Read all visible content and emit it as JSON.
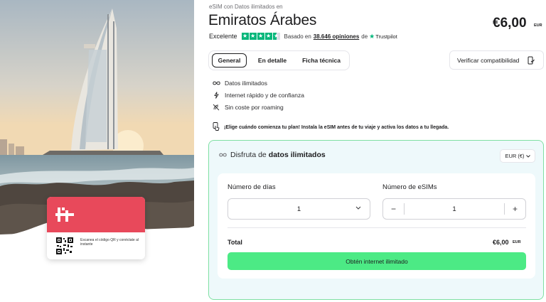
{
  "product": {
    "supertitle": "eSIM con Datos ilimitados en",
    "title": "Emiratos Árabes",
    "price": "€6,00",
    "price_currency": "EUR"
  },
  "rating": {
    "label": "Excelente",
    "stars": 4.5,
    "based_on": "Basado en",
    "count": "38.646 opiniones",
    "of": "de",
    "provider": "Trustpilot"
  },
  "tabs": [
    {
      "label": "General",
      "active": true
    },
    {
      "label": "En detalle",
      "active": false
    },
    {
      "label": "Ficha técnica",
      "active": false
    }
  ],
  "verify_button": "Verificar compatibilidad",
  "features": [
    {
      "icon": "infinity-icon",
      "text": "Datos ilimitados"
    },
    {
      "icon": "lightning-icon",
      "text": "Internet rápido y de confianza"
    },
    {
      "icon": "no-roaming-icon",
      "text": "Sin coste por roaming"
    }
  ],
  "notice": "¡Elige cuándo comienza tu plan! Instala la eSIM antes de tu viaje y activa los datos a tu llegada.",
  "card": {
    "qr_text": "Escanea el código QR y conéctate al instante"
  },
  "panel": {
    "heading_prefix": "Disfruta de",
    "heading_bold": "datos ilimitados",
    "currency_select": "EUR (€)",
    "days_label": "Número de días",
    "days_value": "1",
    "esims_label": "Número de eSIMs",
    "esims_value": "1",
    "minus": "−",
    "plus": "+",
    "total_label": "Total",
    "total_value": "€6,00",
    "total_currency": "EUR",
    "cta": "Obtén internet ilimitado"
  },
  "colors": {
    "accent_green": "#4cea85",
    "panel_border": "#7fe0a3",
    "panel_bg": "#eef9fb",
    "brand_red": "#e8495b",
    "trustpilot": "#00b67a"
  }
}
